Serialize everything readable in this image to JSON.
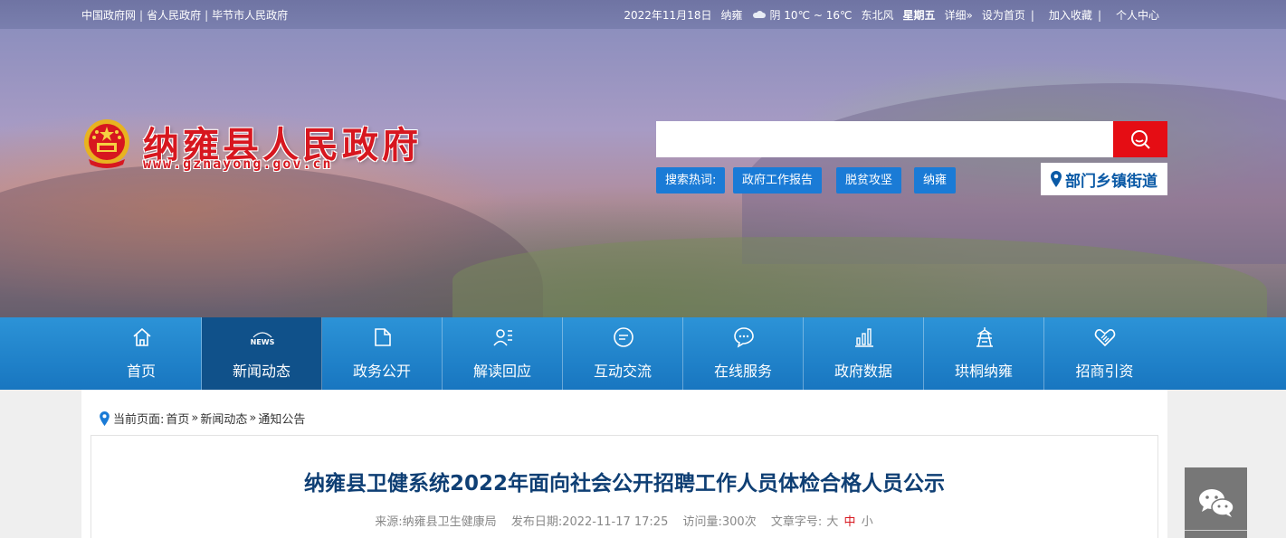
{
  "topbar": {
    "links": [
      "中国政府网",
      "省人民政府",
      "毕节市人民政府"
    ],
    "date": "2022年11月18日",
    "city": "纳雍",
    "weather": "阴 10℃ ~ 16℃",
    "wind": "东北风",
    "weekday": "星期五",
    "detail": "详细»",
    "set_home": "设为首页",
    "bookmark": "加入收藏",
    "personal": "个人中心"
  },
  "header": {
    "site_title": "纳雍县人民政府",
    "site_url": "www.gznayong.gov.cn",
    "search_placeholder": "",
    "hot_label": "搜索热词:",
    "hot_words": [
      "政府工作报告",
      "脱贫攻坚",
      "纳雍"
    ],
    "dept_link": "部门乡镇街道"
  },
  "nav": {
    "items": [
      {
        "label": "首页",
        "icon": "home-icon"
      },
      {
        "label": "新闻动态",
        "icon": "news-icon",
        "badge": "NEWS"
      },
      {
        "label": "政务公开",
        "icon": "folder-icon"
      },
      {
        "label": "解读回应",
        "icon": "reader-icon"
      },
      {
        "label": "互动交流",
        "icon": "chat-icon"
      },
      {
        "label": "在线服务",
        "icon": "service-icon"
      },
      {
        "label": "政府数据",
        "icon": "chart-icon"
      },
      {
        "label": "珙桐纳雍",
        "icon": "tower-icon"
      },
      {
        "label": "招商引资",
        "icon": "handshake-icon"
      }
    ],
    "active_index": 1
  },
  "breadcrumb": {
    "prefix": "当前页面:",
    "items": [
      "首页",
      "新闻动态",
      "通知公告"
    ],
    "separator": "»"
  },
  "article": {
    "title": "纳雍县卫健系统2022年面向社会公开招聘工作人员体检合格人员公示",
    "source_label": "来源:",
    "source": "纳雍县卫生健康局",
    "date_label": "发布日期:",
    "date": "2022-11-17 17:25",
    "views_label": "访问量:",
    "views": "300次",
    "font_label": "文章字号:",
    "font_sizes": [
      "大",
      "中",
      "小"
    ]
  },
  "colors": {
    "nav": "#1876c0",
    "nav_active": "#10518a",
    "search_button": "#e50d14",
    "title_red": "#d7171f",
    "article_title": "#0f3f74"
  }
}
